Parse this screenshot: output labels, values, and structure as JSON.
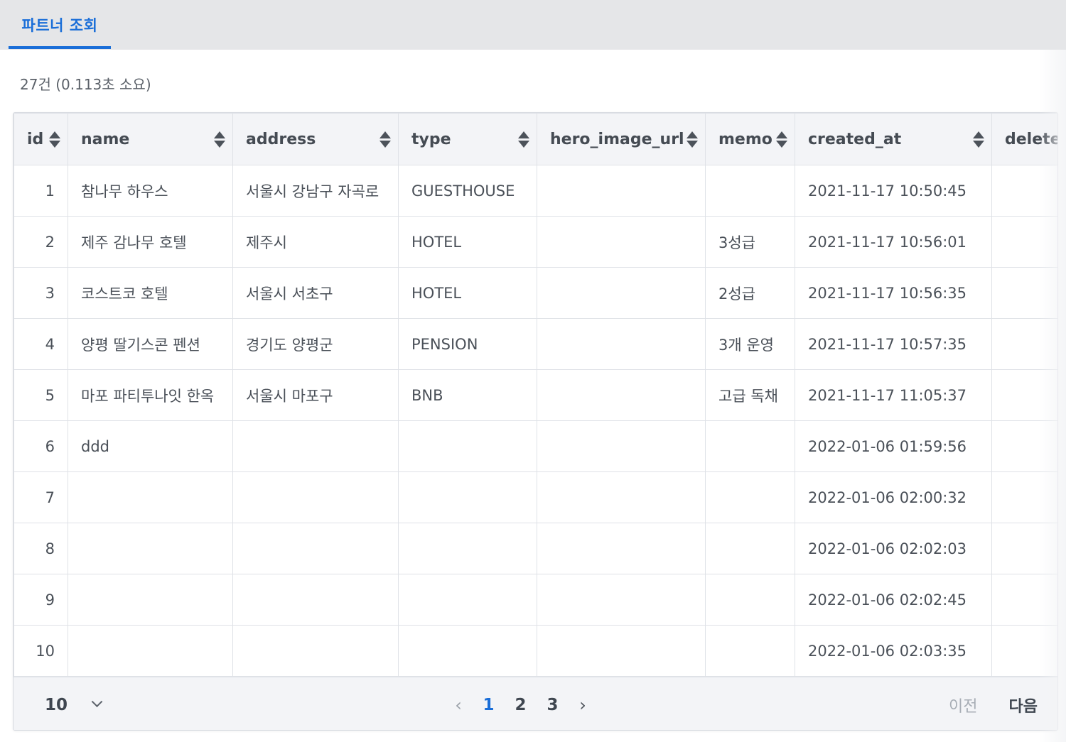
{
  "tab": {
    "label": "파트너 조회"
  },
  "summary": "27건 (0.113초 소요)",
  "table": {
    "columns": [
      "id",
      "name",
      "address",
      "type",
      "hero_image_url",
      "memo",
      "created_at",
      "delete"
    ],
    "rows": [
      [
        "1",
        "참나무 하우스",
        "서울시 강남구 자곡로",
        "GUESTHOUSE",
        "",
        "",
        "2021-11-17 10:50:45",
        ""
      ],
      [
        "2",
        "제주 감나무 호텔",
        "제주시",
        "HOTEL",
        "",
        "3성급",
        "2021-11-17 10:56:01",
        ""
      ],
      [
        "3",
        "코스트코 호텔",
        "서울시 서초구",
        "HOTEL",
        "",
        "2성급",
        "2021-11-17 10:56:35",
        ""
      ],
      [
        "4",
        "양평 딸기스콘 펜션",
        "경기도 양평군",
        "PENSION",
        "",
        "3개 운영",
        "2021-11-17 10:57:35",
        ""
      ],
      [
        "5",
        "마포 파티투나잇 한옥",
        "서울시 마포구",
        "BNB",
        "",
        "고급 독채",
        "2021-11-17 11:05:37",
        ""
      ],
      [
        "6",
        "ddd",
        "",
        "",
        "",
        "",
        "2022-01-06 01:59:56",
        ""
      ],
      [
        "7",
        "",
        "",
        "",
        "",
        "",
        "2022-01-06 02:00:32",
        ""
      ],
      [
        "8",
        "",
        "",
        "",
        "",
        "",
        "2022-01-06 02:02:03",
        ""
      ],
      [
        "9",
        "",
        "",
        "",
        "",
        "",
        "2022-01-06 02:02:45",
        ""
      ],
      [
        "10",
        "",
        "",
        "",
        "",
        "",
        "2022-01-06 02:03:35",
        ""
      ]
    ]
  },
  "footer": {
    "page_size": "10",
    "pages": [
      "1",
      "2",
      "3"
    ],
    "current_page": "1",
    "prev_arrow": "‹",
    "next_arrow": "›",
    "prev_label": "이전",
    "next_label": "다음"
  },
  "colors": {
    "accent": "#1a6ed8",
    "header_bg": "#f3f4f7",
    "tabbar_bg": "#e5e6e8"
  }
}
